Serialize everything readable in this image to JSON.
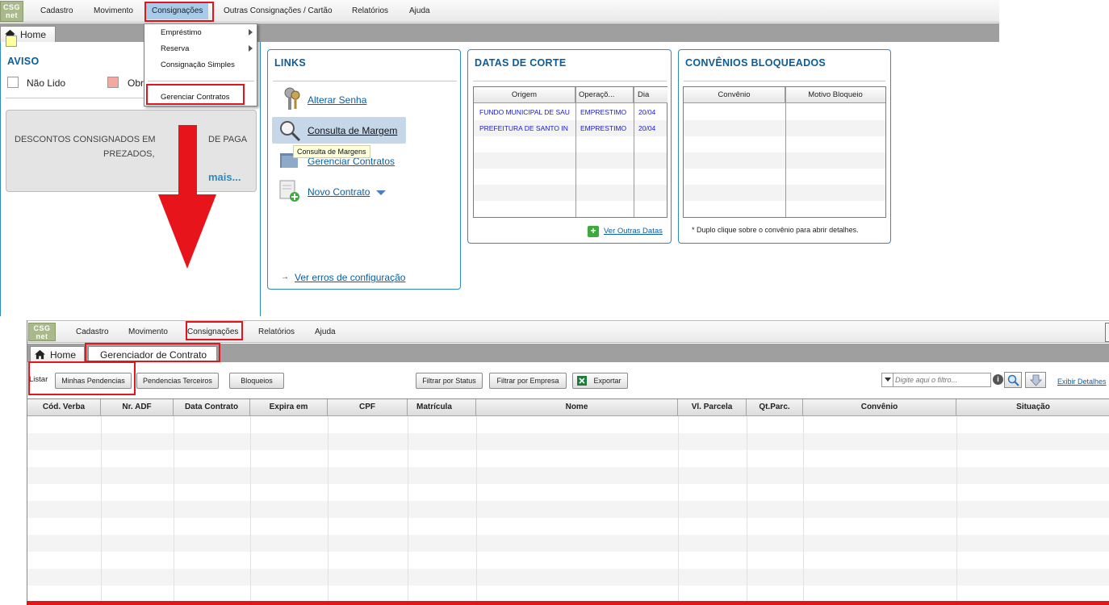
{
  "logo": {
    "line1": "CSG",
    "line2": "net"
  },
  "top_menu": [
    "Cadastro",
    "Movimento",
    "Consignações",
    "Outras Consignações / Cartão",
    "Relatórios",
    "Ajuda"
  ],
  "top_tab": "Home",
  "dropdown": {
    "items": [
      "Empréstimo",
      "Reserva",
      "Consignação Simples",
      "Gerenciar Contratos"
    ]
  },
  "aviso": {
    "title": "AVISO",
    "legend_unread": "Não Lido",
    "legend_mandatory": "Obr",
    "legend_mandatory_color": "#f3a8a0",
    "legend_unread_color": "#ffff9c",
    "notice_line1a": "DESCONTOS CONSIGNADOS EM",
    "notice_line1b": "DE PAGA",
    "notice_line2": "PREZADOS,",
    "more": "mais..."
  },
  "links": {
    "title": "LINKS",
    "items": [
      "Alterar Senha",
      "Consulta de Margem",
      "Gerenciar Contratos",
      "Novo Contrato"
    ],
    "tooltip": "Consulta de Margens",
    "config_errors": "Ver erros de configuração"
  },
  "datas_corte": {
    "title": "DATAS DE CORTE",
    "columns": [
      "Origem",
      "Operaçõ...",
      "Dia"
    ],
    "rows": [
      [
        "FUNDO MUNICIPAL DE SAU",
        "EMPRESTIMO",
        "20/04"
      ],
      [
        "PREFEITURA DE SANTO IN",
        "EMPRESTIMO",
        "20/04"
      ]
    ],
    "see_more": "Ver Outras Datas"
  },
  "convenios": {
    "title": "CONVÊNIOS BLOQUEADOS",
    "columns": [
      "Convênio",
      "Motivo Bloqueio"
    ],
    "footnote": "* Duplo clique sobre o convênio para abrir detalhes."
  },
  "bottom_menu": [
    "Cadastro",
    "Movimento",
    "Consignações",
    "Relatórios",
    "Ajuda"
  ],
  "bottom_tabs": [
    "Home",
    "Gerenciador de Contrato"
  ],
  "toolbar": {
    "list_label": "Listar",
    "buttons": [
      "Minhas Pendencias",
      "Pendencias Terceiros",
      "Bloqueios",
      "Filtrar por Status",
      "Filtrar por Empresa",
      "Exportar"
    ],
    "filter_placeholder": "Digite aqui o filtro...",
    "details_link": "Exibir Detalhes"
  },
  "contracts_table": {
    "columns": [
      "Cód. Verba",
      "Nr. ADF",
      "Data Contrato",
      "Expira em",
      "CPF",
      "Matrícula",
      "Nome",
      "Vl. Parcela",
      "Qt.Parc.",
      "Convênio",
      "Situação"
    ]
  },
  "colors": {
    "highlight_red": "#e3141b",
    "panel_border": "#2e8bbf",
    "title_blue": "#0a5c9a"
  }
}
